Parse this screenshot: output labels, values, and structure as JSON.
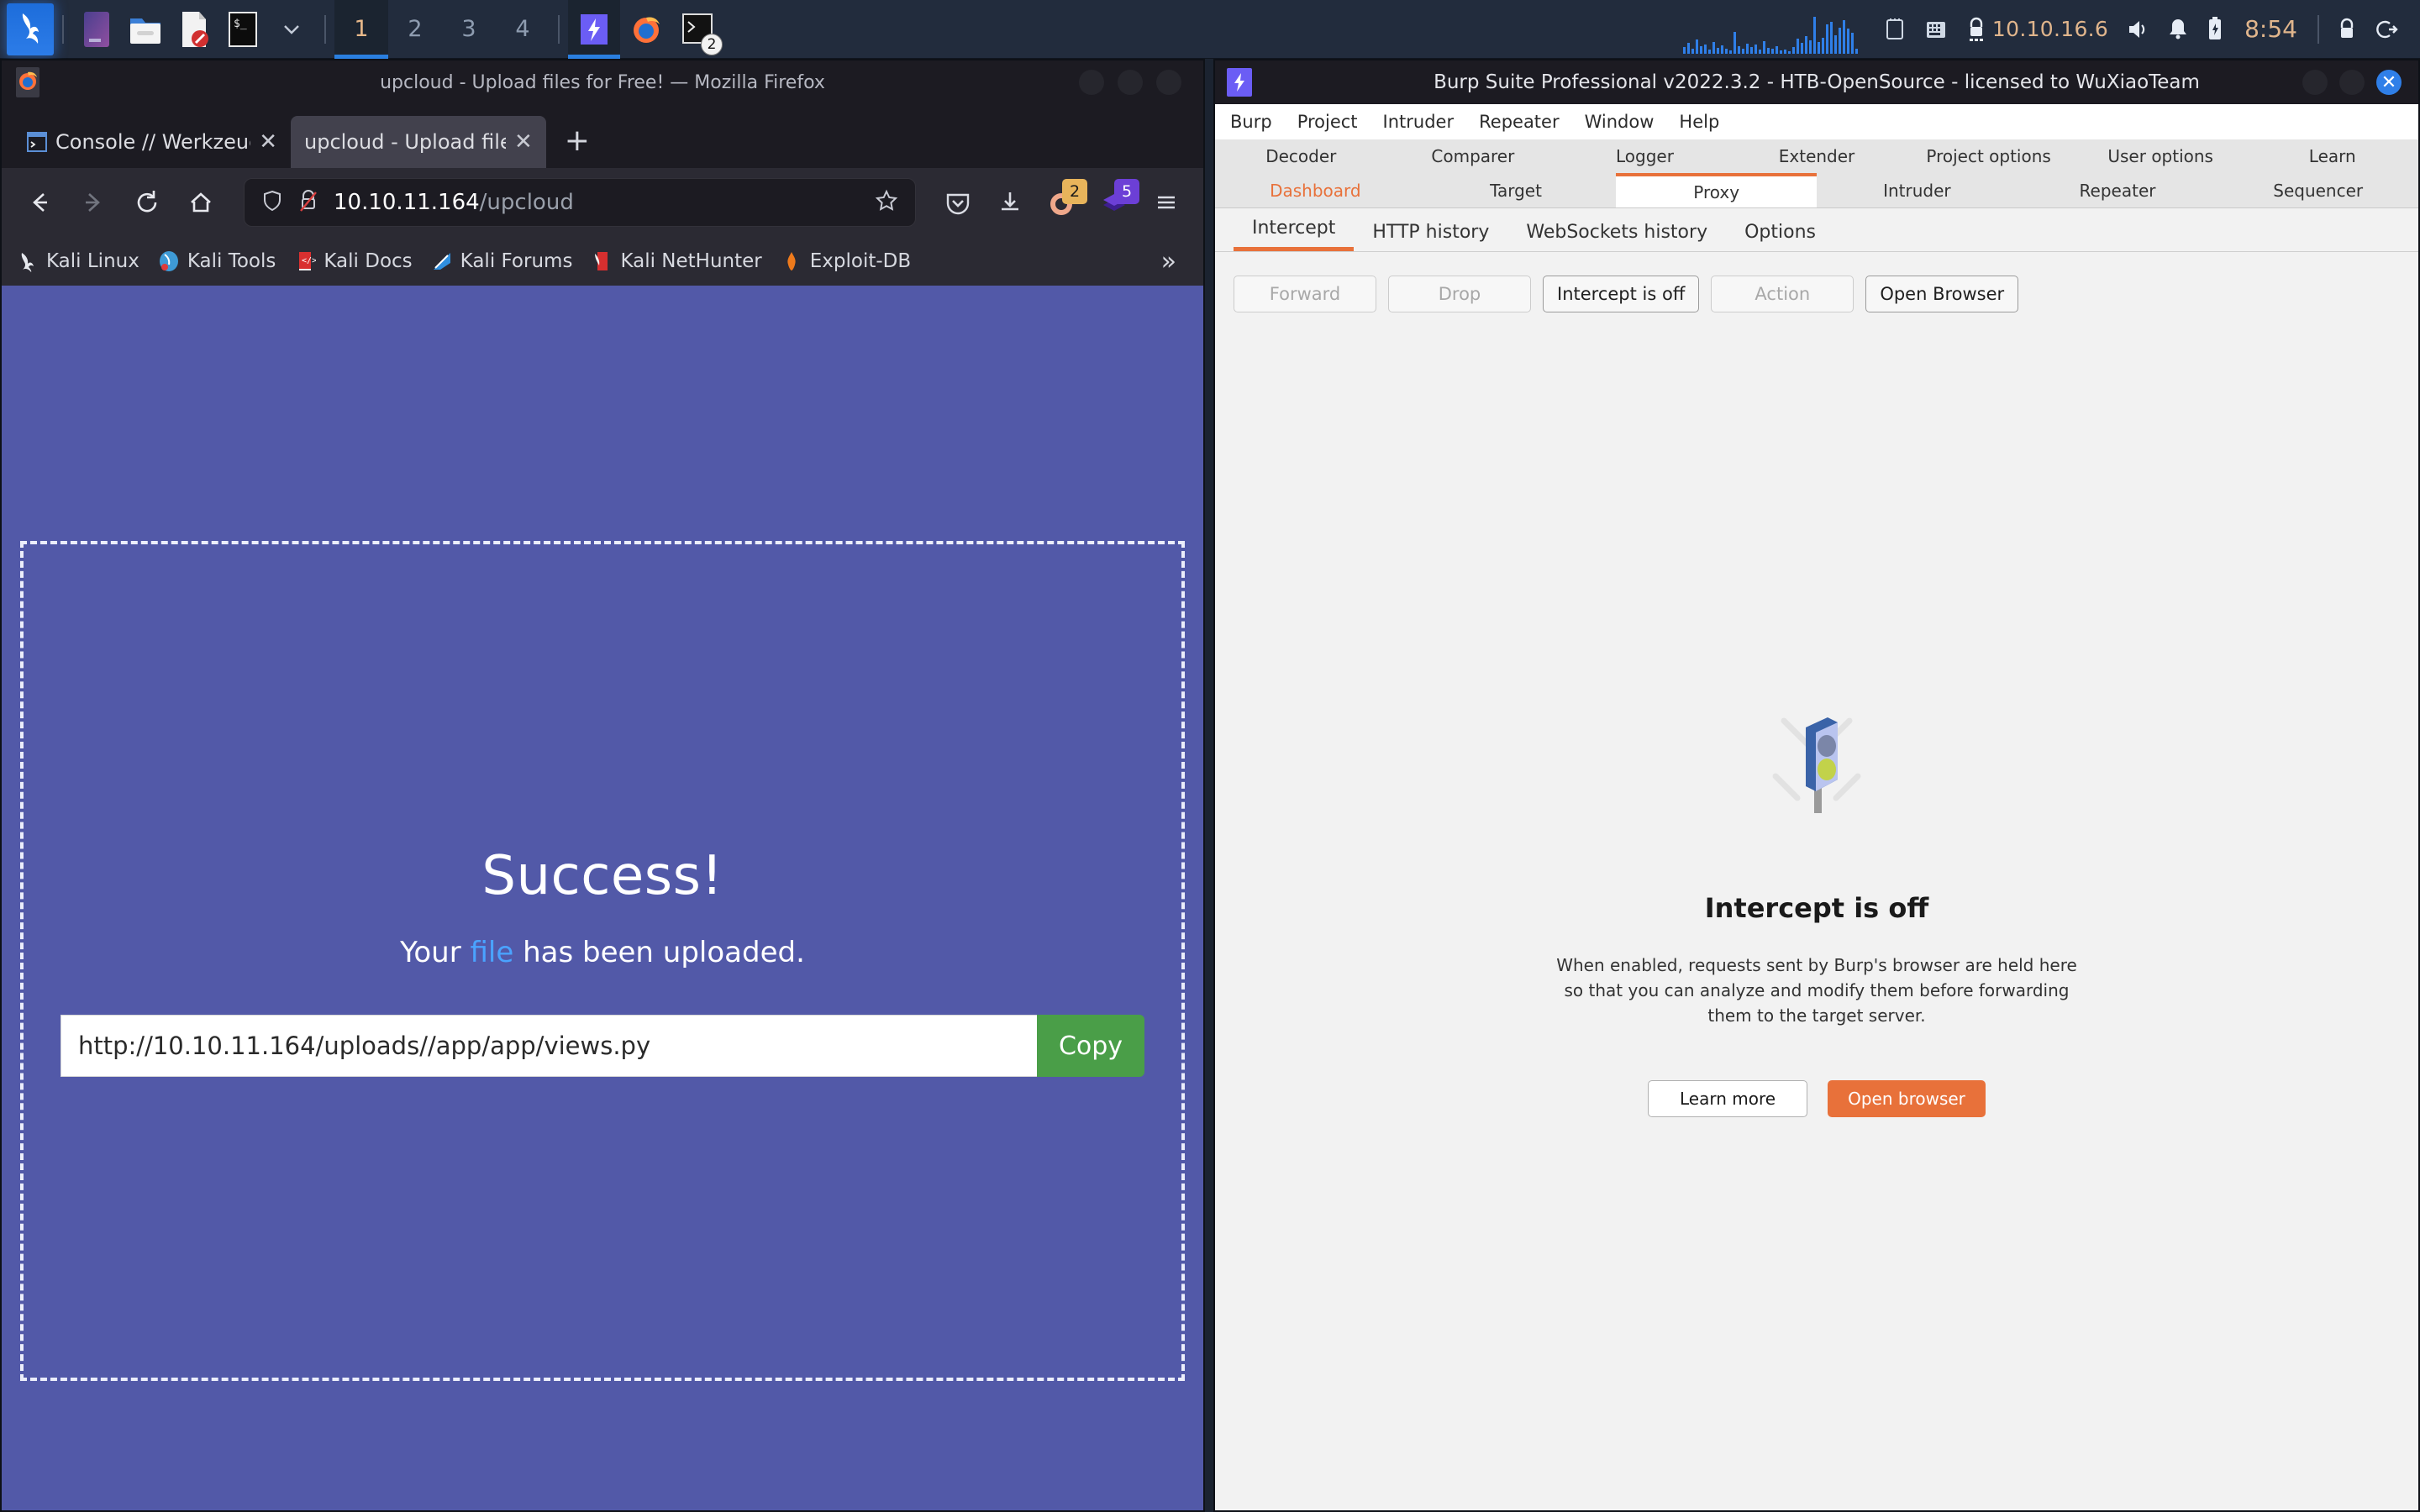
{
  "taskbar": {
    "launchers": [
      {
        "name": "kali-menu-icon",
        "label": "Kali Menu"
      },
      {
        "name": "files-manager-icon",
        "label": "File Manager"
      },
      {
        "name": "folder-icon",
        "label": "Folder"
      },
      {
        "name": "text-editor-icon",
        "label": "Text Editor"
      },
      {
        "name": "terminal-icon",
        "label": "Terminal"
      },
      {
        "name": "chevron-down-icon",
        "label": "More"
      }
    ],
    "workspaces": [
      {
        "label": "1",
        "active": true
      },
      {
        "label": "2",
        "active": false
      },
      {
        "label": "3",
        "active": false
      },
      {
        "label": "4",
        "active": false
      }
    ],
    "running": [
      {
        "name": "burp-suite-task",
        "label": "Burp Suite",
        "active": true,
        "badge": ""
      },
      {
        "name": "firefox-task",
        "label": "Firefox",
        "active": false,
        "badge": ""
      },
      {
        "name": "terminal-task",
        "label": "Terminal",
        "active": false,
        "badge": "2"
      }
    ],
    "tray": {
      "network_icon": "ethernet-icon",
      "keyboard_icon": "keyboard-icon",
      "vpn_icon": "vpn-lock-icon",
      "ip_address": "10.10.16.6",
      "volume_icon": "volume-icon",
      "notifications_icon": "bell-icon",
      "battery_icon": "battery-icon",
      "clock": "8:54",
      "lock_icon": "lock-icon",
      "logout_icon": "power-logout-icon"
    }
  },
  "firefox": {
    "window_title": "upcloud - Upload files for Free! — Mozilla Firefox",
    "tabs": [
      {
        "label": "Console // Werkzeug Debu",
        "active": false,
        "favicon": "console-icon"
      },
      {
        "label": "upcloud - Upload files for Fre",
        "active": true,
        "favicon": "page-icon"
      }
    ],
    "new_tab_label": "+",
    "nav": {
      "back_icon": "back-arrow-icon",
      "forward_icon": "forward-arrow-icon",
      "reload_icon": "reload-icon",
      "home_icon": "home-icon"
    },
    "urlbar": {
      "shield_icon": "shield-icon",
      "security_icon": "insecure-lock-icon",
      "host": "10.10.11.164",
      "path": "/upcloud",
      "full_url": "10.10.11.164/upcloud",
      "bookmark_icon": "star-icon"
    },
    "toolbar_icons": [
      {
        "name": "pocket-icon",
        "badge": ""
      },
      {
        "name": "downloads-icon",
        "badge": ""
      },
      {
        "name": "container-tabs-icon",
        "badge": "2"
      },
      {
        "name": "extension-layers-icon",
        "badge": "5"
      },
      {
        "name": "hamburger-menu-icon",
        "badge": ""
      }
    ],
    "bookmarks": [
      {
        "label": "Kali Linux",
        "icon": "kali-dragon-icon"
      },
      {
        "label": "Kali Tools",
        "icon": "kali-tools-icon"
      },
      {
        "label": "Kali Docs",
        "icon": "kali-docs-icon"
      },
      {
        "label": "Kali Forums",
        "icon": "kali-forums-icon"
      },
      {
        "label": "Kali NetHunter",
        "icon": "kali-nethunter-icon"
      },
      {
        "label": "Exploit-DB",
        "icon": "exploit-db-icon"
      }
    ],
    "bookmarks_overflow": "»"
  },
  "page": {
    "title": "Success!",
    "subtitle_prefix": "Your ",
    "subtitle_link": "file",
    "subtitle_suffix": " has been uploaded.",
    "uploaded_url": "http://10.10.11.164/uploads//app/app/views.py",
    "copy_button": "Copy",
    "background_color": "#5259a8",
    "copy_button_color": "#4a9e48",
    "link_color": "#4aa3ff"
  },
  "burp": {
    "window_title": "Burp Suite Professional v2022.3.2 - HTB-OpenSource - licensed to WuXiaoTeam",
    "menu": [
      "Burp",
      "Project",
      "Intruder",
      "Repeater",
      "Window",
      "Help"
    ],
    "tabs_top": [
      "Decoder",
      "Comparer",
      "Logger",
      "Extender",
      "Project options",
      "User options",
      "Learn"
    ],
    "tabs_main": [
      {
        "label": "Dashboard",
        "state": "dashboard"
      },
      {
        "label": "Target",
        "state": "normal"
      },
      {
        "label": "Proxy",
        "state": "selected"
      },
      {
        "label": "Intruder",
        "state": "normal"
      },
      {
        "label": "Repeater",
        "state": "normal"
      },
      {
        "label": "Sequencer",
        "state": "normal"
      }
    ],
    "subtabs": [
      {
        "label": "Intercept",
        "selected": true
      },
      {
        "label": "HTTP history",
        "selected": false
      },
      {
        "label": "WebSockets history",
        "selected": false
      },
      {
        "label": "Options",
        "selected": false
      }
    ],
    "action_buttons": [
      {
        "label": "Forward",
        "disabled": true
      },
      {
        "label": "Drop",
        "disabled": true
      },
      {
        "label": "Intercept is off",
        "disabled": false
      },
      {
        "label": "Action",
        "disabled": true
      },
      {
        "label": "Open Browser",
        "disabled": false
      }
    ],
    "empty_state": {
      "icon": "traffic-light-icon",
      "heading": "Intercept is off",
      "description": "When enabled, requests sent by Burp's browser are held here so that you can analyze and modify them before forwarding them to the target server.",
      "learn_more_button": "Learn more",
      "open_browser_button": "Open browser"
    },
    "accent_color": "#e8713a"
  }
}
